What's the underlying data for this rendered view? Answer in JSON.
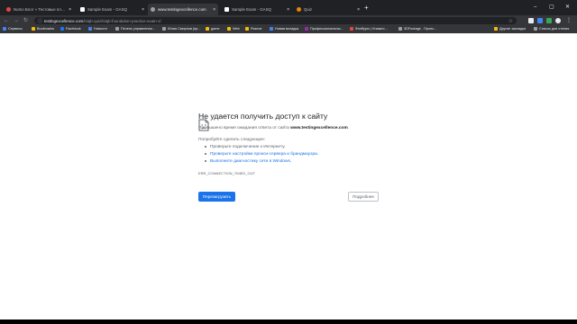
{
  "tabs": [
    {
      "title": "Nomo Блог » Тестовые площадки",
      "favicon_color": "#e8453c",
      "active": false
    },
    {
      "title": "Sample Exam - GASQ",
      "favicon_color": "#ffffff",
      "active": false
    },
    {
      "title": "www.testingexcellence.com",
      "favicon_color": "#9aa0a6",
      "active": true
    },
    {
      "title": "Sample Exam - GASQ",
      "favicon_color": "#ffffff",
      "active": false
    },
    {
      "title": "Quiz",
      "favicon_color": "#ea8600",
      "active": false
    }
  ],
  "tab_close_glyph": "×",
  "new_tab_glyph": "+",
  "window_controls": {
    "minimize": "–",
    "maximize": "▢",
    "close": "✕"
  },
  "toolbar": {
    "back": "←",
    "forward": "→",
    "reload": "↻",
    "url_host": "testingexcellence.com",
    "url_path": "/istqb-quiz/istqb-foundation-practice-exam-1/",
    "lock_glyph": "ⓘ",
    "star_glyph": "☆"
  },
  "bookmarks": [
    {
      "label": "Сервисы",
      "icon_color": "#4285f4"
    },
    {
      "label": "Bookmarks",
      "icon_color": "#fbbc04"
    },
    {
      "label": "Facebook",
      "icon_color": "#1877f2"
    },
    {
      "label": "Новости",
      "icon_color": "#4285f4"
    },
    {
      "label": "Печень управления...",
      "icon_color": "#9aa0a6"
    },
    {
      "label": "Юлия Смирнов (яр...",
      "icon_color": "#9aa0a6"
    },
    {
      "label": "game",
      "icon_color": "#fbbc04"
    },
    {
      "label": "Web",
      "icon_color": "#fbbc04"
    },
    {
      "label": "Разное",
      "icon_color": "#fbbc04"
    },
    {
      "label": "Новая вкладка",
      "icon_color": "#4285f4"
    },
    {
      "label": "Профессиональны...",
      "icon_color": "#9c27b0"
    },
    {
      "label": "Фэнбургс | Книжно...",
      "icon_color": "#e8453c"
    },
    {
      "label": "3DFootage - Проек...",
      "icon_color": "#9aa0a6"
    },
    {
      "label": "Другие закладки",
      "icon_color": "#fbbc04"
    },
    {
      "label": "Список для чтения",
      "icon_color": "#9aa0a6"
    }
  ],
  "error": {
    "title": "Не удается получить доступ к сайту",
    "subtitle_prefix": "Превышено время ожидания ответа от сайта ",
    "subtitle_host": "www.testingexcellence.com",
    "subtitle_suffix": ".",
    "try_label": "Попробуйте сделать следующее:",
    "suggestions": [
      "Проверьте подключение к Интернету.",
      "Проверьте настройки прокси-сервера и брандмауэра.",
      "Выполните диагностику сети в Windows."
    ],
    "code": "ERR_CONNECTION_TIMED_OUT",
    "reload_label": "Перезагрузить",
    "details_label": "Подробнее"
  }
}
